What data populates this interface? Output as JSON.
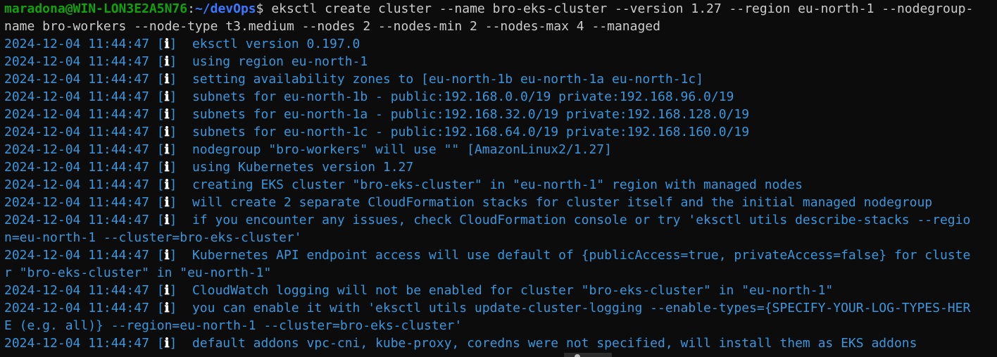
{
  "prompt": {
    "user_host": "maradona@WIN-LON3E2A5N76",
    "colon": ":",
    "path": "~/devOps",
    "symbol": "$ "
  },
  "command": {
    "line1": "eksctl create cluster --name bro-eks-cluster --version 1.27 --region eu-north-1 --nodegroup-",
    "line2": "name bro-workers --node-type t3.medium --nodes 2 --nodes-min 2 --nodes-max 4 --managed"
  },
  "log": {
    "timestamp": "2024-12-04 11:44:47",
    "bracket_open": " [",
    "info_letter": "ℹ",
    "bracket_close": "]  ",
    "messages": [
      "eksctl version 0.197.0",
      "using region eu-north-1",
      "setting availability zones to [eu-north-1b eu-north-1a eu-north-1c]",
      "subnets for eu-north-1b - public:192.168.0.0/19 private:192.168.96.0/19",
      "subnets for eu-north-1a - public:192.168.32.0/19 private:192.168.128.0/19",
      "subnets for eu-north-1c - public:192.168.64.0/19 private:192.168.160.0/19",
      "nodegroup \"bro-workers\" will use \"\" [AmazonLinux2/1.27]",
      "using Kubernetes version 1.27",
      "creating EKS cluster \"bro-eks-cluster\" in \"eu-north-1\" region with managed nodes",
      "will create 2 separate CloudFormation stacks for cluster itself and the initial managed nodegroup",
      "if you encounter any issues, check CloudFormation console or try 'eksctl utils describe-stacks --regio",
      "Kubernetes API endpoint access will use default of {publicAccess=true, privateAccess=false} for cluste",
      "CloudWatch logging will not be enabled for cluster \"bro-eks-cluster\" in \"eu-north-1\"",
      "you can enable it with 'eksctl utils update-cluster-logging --enable-types={SPECIFY-YOUR-LOG-TYPES-HER",
      "default addons vpc-cni, kube-proxy, coredns were not specified, will install them as EKS addons"
    ],
    "continuations": [
      "n=eu-north-1 --cluster=bro-eks-cluster'",
      "r \"bro-eks-cluster\" in \"eu-north-1\"",
      "E (e.g. all)} --region=eu-north-1 --cluster=bro-eks-cluster'"
    ]
  },
  "colors": {
    "background": "#0c0c0c",
    "prompt_user": "#13a10e",
    "prompt_path": "#3b78ff",
    "log_text": "#3a96dd",
    "info_icon": "#ffffff"
  }
}
